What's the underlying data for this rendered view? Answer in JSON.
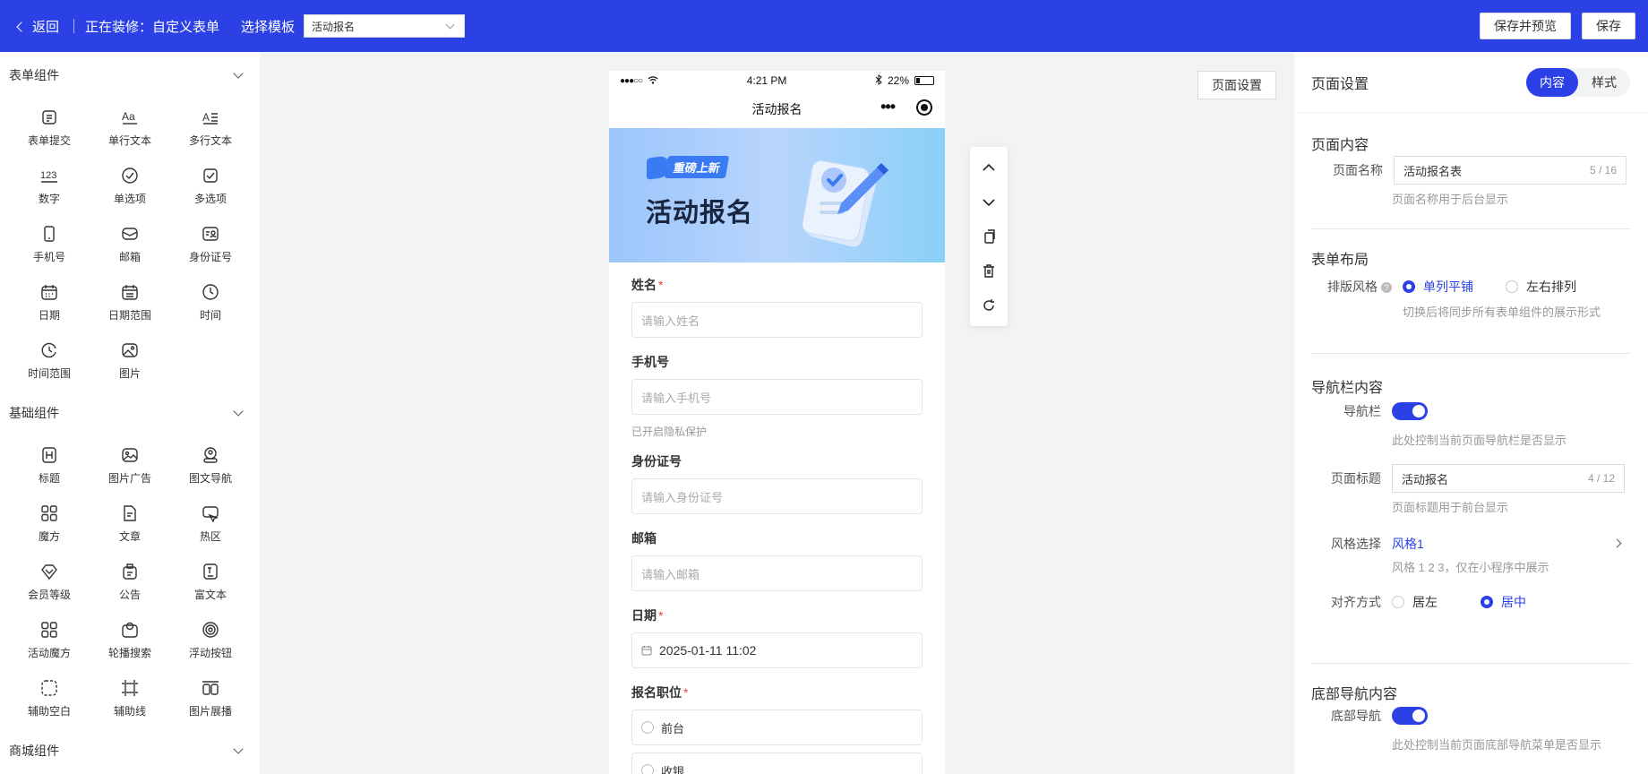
{
  "topbar": {
    "back_label": "返回",
    "editing_label": "正在装修：自定义表单",
    "template_label": "选择模板",
    "template_value": "活动报名",
    "save_preview_label": "保存并预览",
    "save_label": "保存",
    "bg_color": "#2b41e6"
  },
  "left": {
    "groups": [
      {
        "title": "表单组件",
        "items": [
          {
            "label": "表单提交",
            "icon": "form-submit-icon"
          },
          {
            "label": "单行文本",
            "icon": "text-single-icon"
          },
          {
            "label": "多行文本",
            "icon": "text-multi-icon"
          },
          {
            "label": "数字",
            "icon": "number-icon"
          },
          {
            "label": "单选项",
            "icon": "radio-icon"
          },
          {
            "label": "多选项",
            "icon": "checkbox-icon"
          },
          {
            "label": "手机号",
            "icon": "phone-icon"
          },
          {
            "label": "邮箱",
            "icon": "mail-icon"
          },
          {
            "label": "身份证号",
            "icon": "id-card-icon"
          },
          {
            "label": "日期",
            "icon": "calendar-icon"
          },
          {
            "label": "日期范围",
            "icon": "calendar-range-icon"
          },
          {
            "label": "时间",
            "icon": "clock-icon"
          },
          {
            "label": "时间范围",
            "icon": "clock-range-icon"
          },
          {
            "label": "图片",
            "icon": "image-icon"
          }
        ]
      },
      {
        "title": "基础组件",
        "items": [
          {
            "label": "标题",
            "icon": "heading-icon"
          },
          {
            "label": "图片广告",
            "icon": "image-ad-icon"
          },
          {
            "label": "图文导航",
            "icon": "image-nav-icon"
          },
          {
            "label": "魔方",
            "icon": "cube-icon"
          },
          {
            "label": "文章",
            "icon": "article-icon"
          },
          {
            "label": "热区",
            "icon": "hotspot-icon"
          },
          {
            "label": "会员等级",
            "icon": "member-level-icon"
          },
          {
            "label": "公告",
            "icon": "notice-icon"
          },
          {
            "label": "富文本",
            "icon": "rich-text-icon"
          },
          {
            "label": "活动魔方",
            "icon": "activity-cube-icon"
          },
          {
            "label": "轮播搜索",
            "icon": "carousel-search-icon"
          },
          {
            "label": "浮动按钮",
            "icon": "float-button-icon"
          },
          {
            "label": "辅助空白",
            "icon": "blank-icon"
          },
          {
            "label": "辅助线",
            "icon": "guide-line-icon"
          },
          {
            "label": "图片展播",
            "icon": "image-showcase-icon"
          }
        ]
      },
      {
        "title": "商城组件",
        "items": []
      }
    ]
  },
  "phone": {
    "status": {
      "signal": "●●●○○",
      "time": "4:21 PM",
      "battery": "22%"
    },
    "nav_title": "活动报名",
    "banner": {
      "badge": "重磅上新",
      "title": "活动报名"
    },
    "fields": {
      "name": {
        "label": "姓名",
        "placeholder": "请输入姓名"
      },
      "mobile": {
        "label": "手机号",
        "placeholder": "请输入手机号",
        "hint": "已开启隐私保护"
      },
      "idcard": {
        "label": "身份证号",
        "placeholder": "请输入身份证号"
      },
      "email": {
        "label": "邮箱",
        "placeholder": "请输入邮箱"
      },
      "date": {
        "label": "日期",
        "value": "2025-01-11 11:02"
      },
      "position": {
        "label": "报名职位",
        "options": [
          "前台",
          "收银"
        ]
      }
    }
  },
  "canvas": {
    "page_settings_label": "页面设置"
  },
  "right": {
    "title": "页面设置",
    "tabs": [
      "内容",
      "样式"
    ],
    "page_content": {
      "title": "页面内容",
      "name_label": "页面名称",
      "name_value": "活动报名表",
      "name_count": "5 / 16",
      "name_hint": "页面名称用于后台显示"
    },
    "form_layout": {
      "title": "表单布局",
      "style_label": "排版风格",
      "options": [
        "单列平铺",
        "左右排列"
      ],
      "hint": "切换后将同步所有表单组件的展示形式"
    },
    "navbar": {
      "title": "导航栏内容",
      "toggle_label": "导航栏",
      "toggle_hint": "此处控制当前页面导航栏是否显示",
      "page_title_label": "页面标题",
      "page_title_value": "活动报名",
      "page_title_count": "4 / 12",
      "page_title_hint": "页面标题用于前台显示",
      "style_label": "风格选择",
      "style_value": "风格1",
      "style_hint": "风格 1 2 3，仅在小程序中展示",
      "align_label": "对齐方式",
      "align_options": [
        "居左",
        "居中"
      ]
    },
    "bottom_nav": {
      "title": "底部导航内容",
      "toggle_label": "底部导航",
      "toggle_hint": "此处控制当前页面底部导航菜单是否显示"
    }
  }
}
